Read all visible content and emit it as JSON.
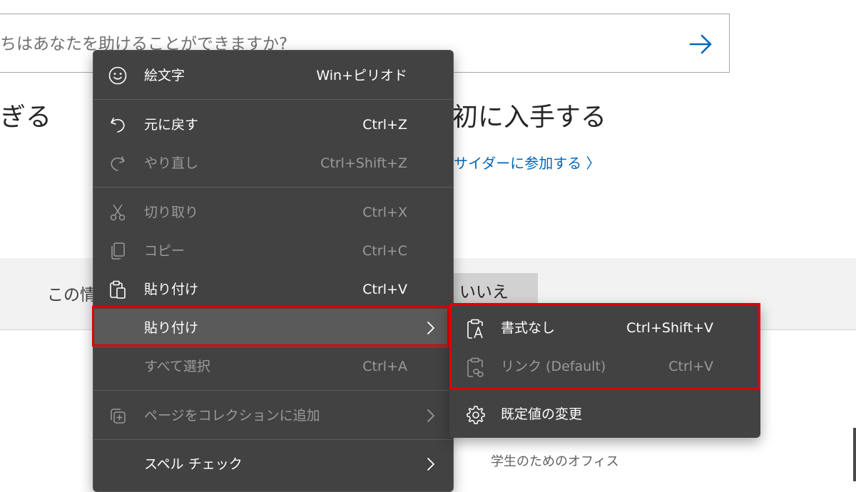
{
  "page": {
    "search_text": "ちはあなたを助けることができますか?",
    "heading_left": "ぎる",
    "heading_right": "初に入手する",
    "insider_link": "サイダーに参加する 〉",
    "feedback_text": "この情",
    "no_button": "いいえ",
    "footer_link": "学生のためのオフィス"
  },
  "context_menu": {
    "items": [
      {
        "label": "絵文字",
        "shortcut": "Win+ピリオド",
        "icon": "smiley-icon",
        "enabled": true
      },
      {
        "label": "元に戻す",
        "shortcut": "Ctrl+Z",
        "icon": "undo-icon",
        "enabled": true
      },
      {
        "label": "やり直し",
        "shortcut": "Ctrl+Shift+Z",
        "icon": "redo-icon",
        "enabled": false
      },
      {
        "label": "切り取り",
        "shortcut": "Ctrl+X",
        "icon": "scissors-icon",
        "enabled": false
      },
      {
        "label": "コピー",
        "shortcut": "Ctrl+C",
        "icon": "copy-icon",
        "enabled": false
      },
      {
        "label": "貼り付け",
        "shortcut": "Ctrl+V",
        "icon": "clipboard-icon",
        "enabled": true
      },
      {
        "label": "貼り付け",
        "shortcut": "",
        "icon": "chevron-right-icon",
        "enabled": true,
        "highlighted": true
      },
      {
        "label": "すべて選択",
        "shortcut": "Ctrl+A",
        "icon": "",
        "enabled": false
      },
      {
        "label": "ページをコレクションに追加",
        "shortcut": "",
        "icon": "collections-add-icon",
        "enabled": false
      },
      {
        "label": "スペル チェック",
        "shortcut": "",
        "icon": "",
        "enabled": true
      }
    ]
  },
  "submenu": {
    "items": [
      {
        "label": "書式なし",
        "shortcut": "Ctrl+Shift+V",
        "icon": "paste-plain-text-icon",
        "enabled": true
      },
      {
        "label": "リンク (Default)",
        "shortcut": "Ctrl+V",
        "icon": "paste-link-icon",
        "enabled": false
      },
      {
        "label": "既定値の変更",
        "shortcut": "",
        "icon": "gear-icon",
        "enabled": true
      }
    ]
  },
  "colors": {
    "menu_bg": "#424242",
    "highlight_bg": "#5a5a5a",
    "annotation_red": "#e00000",
    "link_blue": "#0067b8"
  }
}
